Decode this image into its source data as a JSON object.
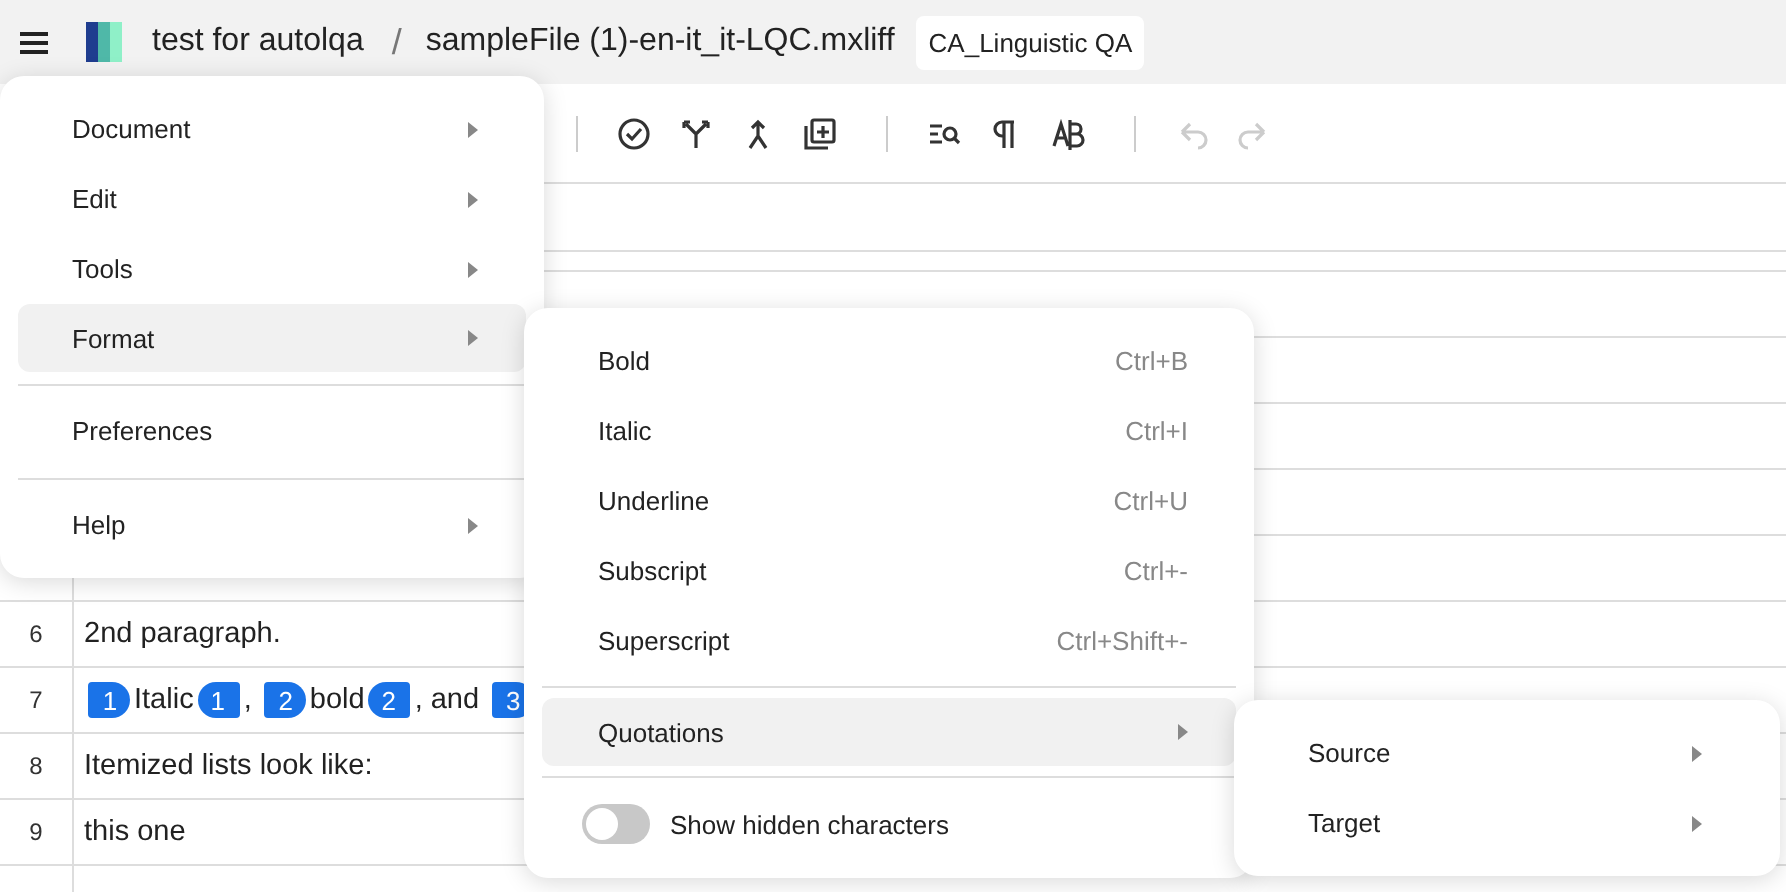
{
  "topbar": {
    "project": "test for autolqa",
    "separator": "/",
    "file": "sampleFile (1)-en-it_it-LQC.mxliff",
    "workflow_badge": "CA_Linguistic QA"
  },
  "toolbar": {
    "groups": [
      [
        {
          "kind": "check",
          "disabled": false
        },
        {
          "kind": "split",
          "disabled": false
        },
        {
          "kind": "join",
          "disabled": false
        },
        {
          "kind": "add",
          "disabled": false
        }
      ],
      [
        {
          "kind": "find",
          "disabled": false
        },
        {
          "kind": "pilcrow",
          "disabled": false
        },
        {
          "kind": "spell",
          "disabled": false
        }
      ],
      [
        {
          "kind": "undo",
          "disabled": true
        },
        {
          "kind": "redo",
          "disabled": true
        }
      ]
    ]
  },
  "segments": [
    {
      "number": "6",
      "parts": [
        {
          "kind": "text",
          "text": "2nd paragraph."
        }
      ]
    },
    {
      "number": "7",
      "parts": [
        {
          "kind": "tag_open",
          "text": "1"
        },
        {
          "kind": "text",
          "text": "Italic"
        },
        {
          "kind": "tag_close",
          "text": "1"
        },
        {
          "kind": "text",
          "text": ", "
        },
        {
          "kind": "tag_open",
          "text": "2"
        },
        {
          "kind": "text",
          "text": "bold"
        },
        {
          "kind": "tag_close",
          "text": "2"
        },
        {
          "kind": "text",
          "text": ", and "
        },
        {
          "kind": "tag_open",
          "text": "3"
        }
      ]
    },
    {
      "number": "8",
      "parts": [
        {
          "kind": "text",
          "text": "Itemized lists look like:"
        }
      ]
    },
    {
      "number": "9",
      "parts": [
        {
          "kind": "text",
          "text": "this one"
        }
      ]
    }
  ],
  "main_menu": [
    {
      "label": "Document",
      "submenu": true,
      "selected": false
    },
    {
      "label": "Edit",
      "submenu": true,
      "selected": false
    },
    {
      "label": "Tools",
      "submenu": true,
      "selected": false
    },
    {
      "label": "Format",
      "submenu": true,
      "selected": true,
      "divider_after": true
    },
    {
      "label": "Preferences",
      "submenu": false,
      "selected": false,
      "divider_after": true
    },
    {
      "label": "Help",
      "submenu": true,
      "selected": false
    }
  ],
  "format_menu": [
    {
      "kind": "item",
      "label": "Bold",
      "shortcut": "Ctrl+B"
    },
    {
      "kind": "item",
      "label": "Italic",
      "shortcut": "Ctrl+I"
    },
    {
      "kind": "item",
      "label": "Underline",
      "shortcut": "Ctrl+U"
    },
    {
      "kind": "item",
      "label": "Subscript",
      "shortcut": "Ctrl+-"
    },
    {
      "kind": "item",
      "label": "Superscript",
      "shortcut": "Ctrl+Shift+-"
    },
    {
      "kind": "divider"
    },
    {
      "kind": "submenu",
      "label": "Quotations",
      "selected": true
    },
    {
      "kind": "divider"
    },
    {
      "kind": "toggle",
      "label": "Show hidden characters",
      "on": false
    }
  ],
  "quotations_menu": [
    {
      "label": "Source",
      "submenu": true
    },
    {
      "label": "Target",
      "submenu": true
    }
  ]
}
